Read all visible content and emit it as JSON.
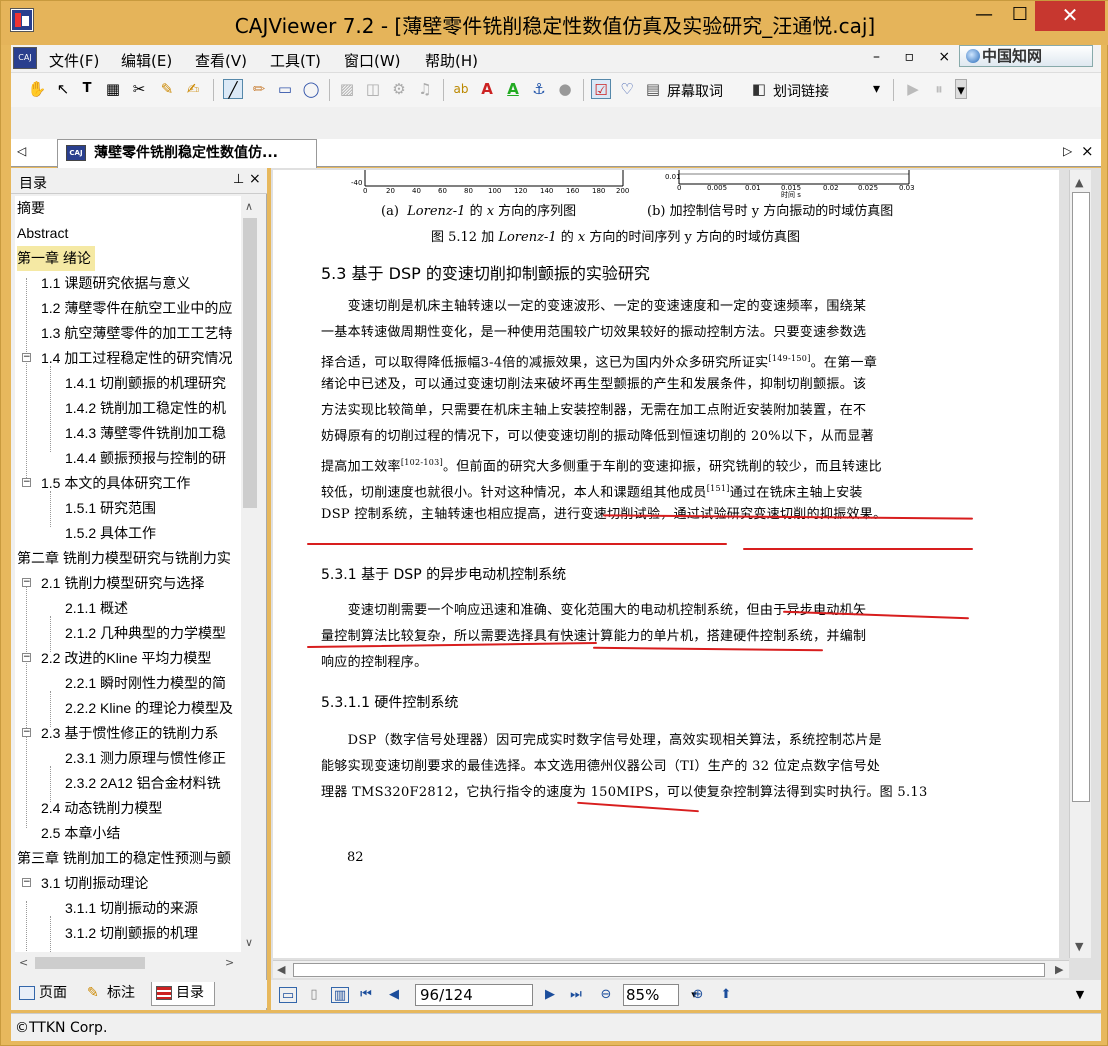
{
  "window": {
    "title": "CAJViewer 7.2 - [薄壁零件铣削稳定性数值仿真及实验研究_汪通悦.caj]",
    "min": "—",
    "max": "☐",
    "close": "✕"
  },
  "menu": [
    "文件(F)",
    "编辑(E)",
    "查看(V)",
    "工具(T)",
    "窗口(W)",
    "帮助(H)"
  ],
  "mdi_controls": "–  ▫  ×",
  "cnki_label": "中国知网",
  "toolbar": {
    "screen_word": "屏幕取词",
    "word_link": "划词链接",
    "dropdown": "▾"
  },
  "tab": {
    "label": "薄壁零件铣削稳定性数值仿...",
    "left_arrow": "◁",
    "right_arrow": "▷",
    "close": "×"
  },
  "toc": {
    "title": "目录",
    "pin": "⊥",
    "close": "×",
    "items": [
      "摘要",
      "Abstract",
      "第一章 绪论",
      "1.1 课题研究依据与意义",
      "1.2 薄壁零件在航空工业中的应",
      "1.3 航空薄壁零件的加工工艺特",
      "1.4 加工过程稳定性的研究情况",
      "1.4.1 切削颤振的机理研究",
      "1.4.2 铣削加工稳定性的机",
      "1.4.3 薄壁零件铣削加工稳",
      "1.4.4 颤振预报与控制的研",
      "1.5 本文的具体研究工作",
      "1.5.1 研究范围",
      "1.5.2 具体工作",
      "第二章 铣削力模型研究与铣削力实",
      "2.1 铣削力模型研究与选择",
      "2.1.1 概述",
      "2.1.2 几种典型的力学模型",
      "2.2 改进的Kline 平均力模型",
      "2.2.1 瞬时刚性力模型的简",
      "2.2.2 Kline 的理论力模型及",
      "2.3 基于惯性修正的铣削力系",
      "2.3.1 测力原理与惯性修正",
      "2.3.2 2A12 铝合金材料铣",
      "2.4 动态铣削力模型",
      "2.5 本章小结",
      "第三章 铣削加工的稳定性预测与颤",
      "3.1 切削振动理论",
      "3.1.1 切削振动的来源",
      "3.1.2 切削颤振的机理"
    ],
    "scroll_up": "∧",
    "scroll_down": "∨",
    "scroll_left": "<",
    "scroll_right": ">"
  },
  "panel_tabs": [
    "页面",
    "标注",
    "目录"
  ],
  "doc": {
    "chart_axis": {
      "left_ticks": [
        "-40",
        "0",
        "20",
        "40",
        "60",
        "80",
        "100",
        "120",
        "140",
        "160",
        "180",
        "200"
      ],
      "right_ticks": [
        "0.01",
        "0",
        "0.005",
        "0.01",
        "0.015",
        "0.02",
        "0.025",
        "0.03"
      ],
      "right_xlabel": "时间 s"
    },
    "caption_a_prefix": "(a)",
    "caption_a_italic": "Lorenz-1",
    "caption_a_mid": " 的 ",
    "caption_a_var": "x",
    "caption_a_suffix": " 方向的序列图",
    "caption_b": "(b)  加控制信号时 y 方向振动的时域仿真图",
    "figure_caption_prefix": "图 5.12  加 ",
    "figure_caption_italic": "Lorenz-1",
    "figure_caption_mid": " 的 ",
    "figure_caption_var": "x",
    "figure_caption_suffix": " 方向的时间序列 y 方向的时域仿真图",
    "section_53": "5.3 基于 DSP 的变速切削抑制颤振的实验研究",
    "para1": [
      "　　变速切削是机床主轴转速以一定的变速波形、一定的变速速度和一定的变速频率，围绕某",
      "一基本转速做周期性变化，是一种使用范围较广切效果较好的振动控制方法。只要变速参数选",
      "择合适，可以取得降低振幅3-4倍的减振效果，这已为国内外众多研究所证实",
      "绪论中已述及，可以通过变速切削法来破坏再生型颤振的产生和发展条件，抑制切削颤振。该",
      "方法实现比较简单，只需要在机床主轴上安装控制器，无需在加工点附近安装附加装置，在不",
      "妨碍原有的切削过程的情况下，可以使变速切削的振动降低到恒速切削的 20%以下，从而显著",
      "提高加工效率",
      "较低，切削速度也就很小。针对这种情况，本人和课题组其他成员",
      "DSP 控制系统，主轴转速也相应提高，进行变速切削试验，通过试验研究变速切削的抑振效果。"
    ],
    "ref_149": "[149-150]",
    "after_ref_149": "。在第一章",
    "ref_102": "[102-103]",
    "after_ref_102": "。但前面的研究大多侧重于车削的变速抑振，研究铣削的较少，而且转速比",
    "ref_151": "[151]",
    "after_ref_151": "通过在铣床主轴上安装",
    "section_531": "5.3.1 基于 DSP 的异步电动机控制系统",
    "para2": [
      "　　变速切削需要一个响应迅速和准确、变化范围大的电动机控制系统，但由于异步电动机矢",
      "量控制算法比较复杂，所以需要选择具有快速计算能力的单片机，搭建硬件控制系统，并编制",
      "响应的控制程序。"
    ],
    "section_5311": "5.3.1.1 硬件控制系统",
    "para3": [
      "　　DSP（数字信号处理器）因可完成实时数字信号处理，高效实现相关算法，系统控制芯片是",
      "能够实现变速切削要求的最佳选择。本文选用德州仪器公司（TI）生产的 32 位定点数字信号处",
      "理器 TMS320F2812，它执行指令的速度为 150MIPS，可以使复杂控制算法得到实时执行。图 5.13"
    ],
    "page_number": "82"
  },
  "nav": {
    "page": "96/124",
    "zoom": "85%"
  },
  "status": "©TTKN Corp.",
  "colors": {
    "frame": "#e5b45a",
    "close_red": "#c7372f",
    "selection": "#f5e9a4",
    "annotation_red": "#d81e1e"
  }
}
